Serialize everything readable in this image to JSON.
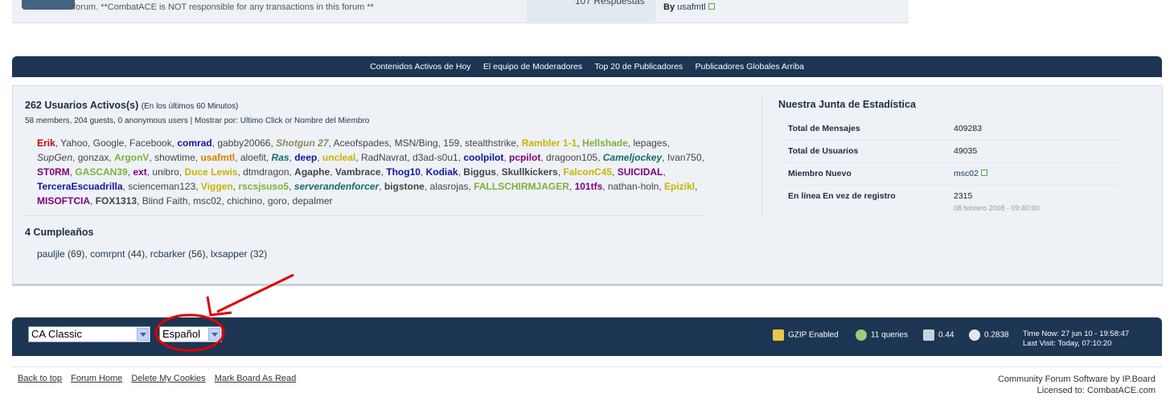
{
  "top_row": {
    "description": "forum. **CombatACE is NOT responsible for any transactions in this forum **",
    "responses": "107 Respuestas",
    "last_by_prefix": "By",
    "last_by_user": "usafmtl"
  },
  "nav": {
    "items": [
      "Contenidos Activos de Hoy",
      "El equipo de Moderadores",
      "Top 20 de Publicadores",
      "Publicadores Globales Arriba"
    ]
  },
  "active_users": {
    "title": "262 Usuarios Activos(s)",
    "period": "(En los últimos 60 Minutos)",
    "summary": "58 members, 204 guests, 0 anonymous users | Mostrar por:",
    "sort_last_click": "Ultimo Click",
    "sort_or": "or",
    "sort_member_name": "Nombre del Miembro",
    "users": [
      {
        "name": "Erik",
        "color": "#cc0000",
        "bold": true
      },
      {
        "name": "Yahoo"
      },
      {
        "name": "Google"
      },
      {
        "name": "Facebook"
      },
      {
        "name": "comrad",
        "color": "#1515a0",
        "bold": true
      },
      {
        "name": "gabby20066"
      },
      {
        "name": "Shotgun 27",
        "color": "#8a8a5a",
        "bold": true,
        "italic": true
      },
      {
        "name": "Aceofspades"
      },
      {
        "name": "MSN/Bing"
      },
      {
        "name": "159"
      },
      {
        "name": "stealthstrike"
      },
      {
        "name": "Rambler 1-1",
        "color": "#c8b400",
        "bold": true
      },
      {
        "name": "Hellshade",
        "color": "#7fb03a",
        "bold": true
      },
      {
        "name": "lepages"
      },
      {
        "name": "SupGen",
        "italic": true
      },
      {
        "name": "gonzax"
      },
      {
        "name": "ArgonV",
        "color": "#7fb03a",
        "bold": true
      },
      {
        "name": "showtime"
      },
      {
        "name": "usafmtl",
        "color": "#e07c00",
        "bold": true
      },
      {
        "name": "aloefit"
      },
      {
        "name": "Ras",
        "color": "#1a6a6a",
        "bold": true,
        "italic": true
      },
      {
        "name": "deep",
        "color": "#1515a0",
        "bold": true
      },
      {
        "name": "uncleal",
        "color": "#c8b400",
        "bold": true
      },
      {
        "name": "RadNavrat"
      },
      {
        "name": "d3ad-s0u1"
      },
      {
        "name": "coolpilot",
        "color": "#1515a0",
        "bold": true
      },
      {
        "name": "pcpilot",
        "color": "#800080",
        "bold": true
      },
      {
        "name": "dragoon105"
      },
      {
        "name": "Cameljockey",
        "color": "#1a6a6a",
        "bold": true,
        "italic": true
      },
      {
        "name": "Ivan750"
      },
      {
        "name": "ST0RM",
        "color": "#800080",
        "bold": true
      },
      {
        "name": "GASCAN39",
        "color": "#7fb03a",
        "bold": true
      },
      {
        "name": "ext",
        "color": "#800080",
        "bold": true
      },
      {
        "name": "unibro"
      },
      {
        "name": "Duce Lewis",
        "color": "#c8b400",
        "bold": true
      },
      {
        "name": "dtmdragon"
      },
      {
        "name": "Agaphe",
        "color": "#444444",
        "bold": true
      },
      {
        "name": "Vambrace",
        "color": "#444444",
        "bold": true
      },
      {
        "name": "Thog10",
        "color": "#1515a0",
        "bold": true
      },
      {
        "name": "Kodiak",
        "color": "#1515a0",
        "bold": true
      },
      {
        "name": "Biggus",
        "color": "#444444",
        "bold": true
      },
      {
        "name": "Skullkickers",
        "color": "#444444",
        "bold": true
      },
      {
        "name": "FalconC45",
        "color": "#c8b400",
        "bold": true
      },
      {
        "name": "SUICIDAL",
        "color": "#800080",
        "bold": true
      },
      {
        "name": "TerceraEscuadrilla",
        "color": "#1515a0",
        "bold": true
      },
      {
        "name": "scienceman123"
      },
      {
        "name": "Viggen",
        "color": "#c8b400",
        "bold": true
      },
      {
        "name": "rscsjsuso5",
        "color": "#7fb03a",
        "bold": true
      },
      {
        "name": "serverandenforcer",
        "color": "#1a6a6a",
        "bold": true,
        "italic": true
      },
      {
        "name": "bigstone",
        "color": "#444444",
        "bold": true
      },
      {
        "name": "alasrojas"
      },
      {
        "name": "FALLSCHIRMJAGER",
        "color": "#7fb03a",
        "bold": true
      },
      {
        "name": "101tfs",
        "color": "#800080",
        "bold": true
      },
      {
        "name": "nathan-holn"
      },
      {
        "name": "Epizikl",
        "color": "#c8b400",
        "bold": true
      },
      {
        "name": "MISOFTCIA",
        "color": "#800080",
        "bold": true
      },
      {
        "name": "FOX1313",
        "color": "#444444",
        "bold": true
      },
      {
        "name": "Blind Faith"
      },
      {
        "name": "msc02"
      },
      {
        "name": "chichino"
      },
      {
        "name": "goro"
      },
      {
        "name": "depalmer"
      }
    ]
  },
  "birthdays": {
    "title": "4 Cumpleaños",
    "people": [
      {
        "name": "pauljle",
        "age": "69"
      },
      {
        "name": "comrpnt",
        "age": "44"
      },
      {
        "name": "rcbarker",
        "age": "56"
      },
      {
        "name": "lxsapper",
        "age": "32"
      }
    ]
  },
  "board_stats": {
    "title": "Nuestra Junta de Estadística",
    "total_posts_label": "Total de Mensajes",
    "total_posts_value": "409283",
    "total_users_label": "Total de Usuarios",
    "total_users_value": "49035",
    "newest_member_label": "Miembro Nuevo",
    "newest_member_value": "msc02",
    "most_online_label": "En línea En vez de registro",
    "most_online_value": "2315",
    "most_online_date": "08 febrero 2008 - 09:40:00"
  },
  "footer": {
    "skin_select": "CA Classic",
    "language_select": "Español",
    "gzip": "GZIP Enabled",
    "queries": "11 queries",
    "load": "0.44",
    "exec_time": "0.2838",
    "time_now": "Time Now: 27 jun 10 - 19:58:47",
    "last_visit": "Last Visit: Today, 07:10:20"
  },
  "bottom_links": {
    "back_to_top": "Back to top",
    "forum_home": "Forum Home",
    "delete_cookies": "Delete My Cookies",
    "mark_read": "Mark Board As Read",
    "software": "Community Forum Software by IP.Board",
    "licensed": "Licensed to: CombatACE.com"
  },
  "colors": {
    "nav_bg": "#1c3654",
    "panel_bg": "#eef2f7",
    "annotation": "#e00000"
  }
}
